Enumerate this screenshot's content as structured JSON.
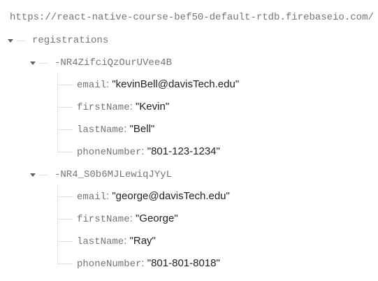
{
  "root_url": "https://react-native-course-bef50-default-rtdb.firebaseio.com/",
  "registrations": {
    "key": "registrations",
    "children": [
      {
        "key": "-NR4ZifciQzOurUVee4B",
        "fields": [
          {
            "name": "email",
            "value": "\"kevinBell@davisTech.edu\""
          },
          {
            "name": "firstName",
            "value": "\"Kevin\""
          },
          {
            "name": "lastName",
            "value": "\"Bell\""
          },
          {
            "name": "phoneNumber",
            "value": "\"801-123-1234\""
          }
        ]
      },
      {
        "key": "-NR4_S0b6MJLewiqJYyL",
        "fields": [
          {
            "name": "email",
            "value": "\"george@davisTech.edu\""
          },
          {
            "name": "firstName",
            "value": "\"George\""
          },
          {
            "name": "lastName",
            "value": "\"Ray\""
          },
          {
            "name": "phoneNumber",
            "value": "\"801-801-8018\""
          }
        ]
      }
    ]
  },
  "colors": {
    "key_text": "#757575",
    "value_text": "#212121",
    "tree_line": "#e0e0e0",
    "toggle_arrow": "#616161"
  },
  "icons": {
    "expand_toggle": "caret-down-icon"
  }
}
